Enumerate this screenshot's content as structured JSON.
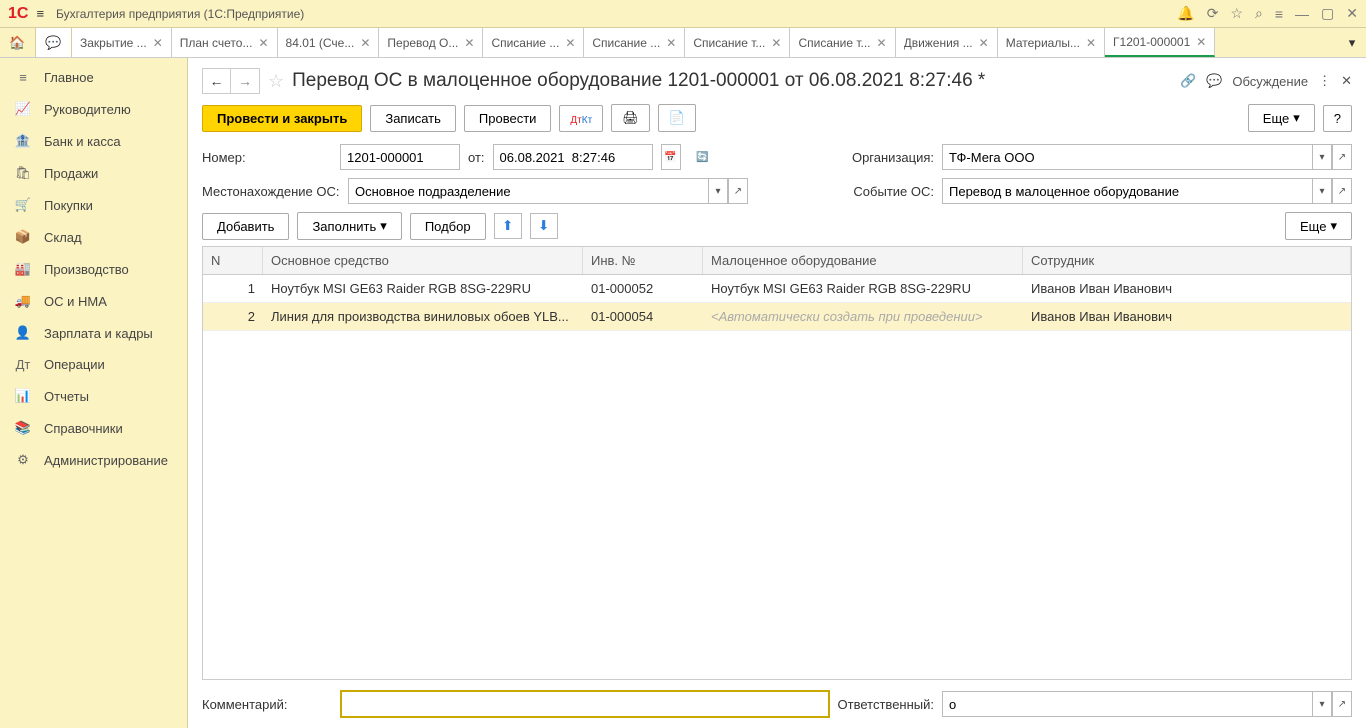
{
  "titlebar": {
    "title": "Бухгалтерия предприятия  (1С:Предприятие)"
  },
  "tabs": [
    {
      "label": "Закрытие ..."
    },
    {
      "label": "План счето..."
    },
    {
      "label": "84.01 (Сче..."
    },
    {
      "label": "Перевод О..."
    },
    {
      "label": "Списание ..."
    },
    {
      "label": "Списание ..."
    },
    {
      "label": "Списание т..."
    },
    {
      "label": "Списание т..."
    },
    {
      "label": "Движения ..."
    },
    {
      "label": "Материалы..."
    },
    {
      "label": "Г1201-000001",
      "active": true
    }
  ],
  "sidebar": [
    {
      "icon": "≡",
      "label": "Главное"
    },
    {
      "icon": "📈",
      "label": "Руководителю"
    },
    {
      "icon": "🏦",
      "label": "Банк и касса"
    },
    {
      "icon": "🛍",
      "label": "Продажи"
    },
    {
      "icon": "🛒",
      "label": "Покупки"
    },
    {
      "icon": "📦",
      "label": "Склад"
    },
    {
      "icon": "🏭",
      "label": "Производство"
    },
    {
      "icon": "🚚",
      "label": "ОС и НМА"
    },
    {
      "icon": "👤",
      "label": "Зарплата и кадры"
    },
    {
      "icon": "Дт",
      "label": "Операции"
    },
    {
      "icon": "📊",
      "label": "Отчеты"
    },
    {
      "icon": "📚",
      "label": "Справочники"
    },
    {
      "icon": "⚙",
      "label": "Администрирование"
    }
  ],
  "page": {
    "title": "Перевод ОС в малоценное оборудование 1201-000001 от 06.08.2021 8:27:46 *",
    "discuss": "Обсуждение"
  },
  "toolbar": {
    "post_close": "Провести и закрыть",
    "save": "Записать",
    "post": "Провести",
    "more": "Еще"
  },
  "form": {
    "number_label": "Номер:",
    "number": "1201-000001",
    "from_label": "от:",
    "date": "06.08.2021  8:27:46",
    "org_label": "Организация:",
    "org": "ТФ-Мега ООО",
    "loc_label": "Местонахождение ОС:",
    "loc": "Основное подразделение",
    "event_label": "Событие ОС:",
    "event": "Перевод в малоценное оборудование"
  },
  "table_toolbar": {
    "add": "Добавить",
    "fill": "Заполнить",
    "select": "Подбор",
    "more": "Еще"
  },
  "table": {
    "headers": {
      "n": "N",
      "os": "Основное средство",
      "inv": "Инв. №",
      "mc": "Малоценное оборудование",
      "emp": "Сотрудник"
    },
    "rows": [
      {
        "n": "1",
        "os": "Ноутбук MSI GE63 Raider RGB 8SG-229RU",
        "inv": "01-000052",
        "mc": "Ноутбук MSI GE63 Raider RGB 8SG-229RU",
        "emp": "Иванов Иван Иванович"
      },
      {
        "n": "2",
        "os": "Линия для производства виниловых обоев YLB...",
        "inv": "01-000054",
        "mc": "<Автоматически создать при проведении>",
        "mc_placeholder": true,
        "emp": "Иванов Иван Иванович",
        "selected": true
      }
    ]
  },
  "footer": {
    "comment_label": "Комментарий:",
    "comment": "",
    "resp_label": "Ответственный:",
    "resp": "о"
  }
}
